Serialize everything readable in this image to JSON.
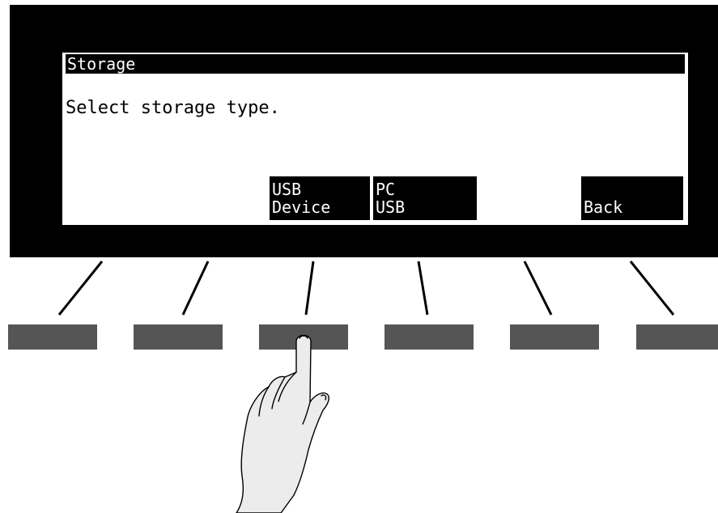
{
  "screen": {
    "title": "Storage",
    "prompt": "Select storage type."
  },
  "soft_labels": [
    {
      "slot": 3,
      "line1": "USB",
      "line2": "Device"
    },
    {
      "slot": 4,
      "line1": "PC",
      "line2": "USB"
    },
    {
      "slot": 6,
      "line1": "",
      "line2": "Back"
    }
  ],
  "colors": {
    "bezel": "#000000",
    "lcd_background": "#ffffff",
    "button": "#555555",
    "hand_fill": "#ececec"
  },
  "icons": {
    "pointer": "pointing-hand-icon"
  }
}
